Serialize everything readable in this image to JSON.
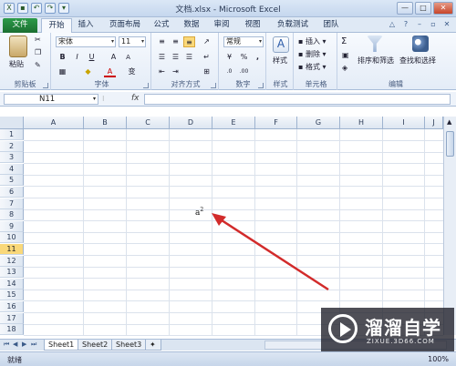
{
  "window": {
    "title": "文档.xlsx - Microsoft Excel",
    "minimize": "—",
    "maximize": "□",
    "close": "✕"
  },
  "tabs": [
    "文件",
    "开始",
    "插入",
    "页面布局",
    "公式",
    "数据",
    "审阅",
    "视图",
    "负载测试",
    "团队"
  ],
  "ribbon": {
    "clipboard": {
      "label": "剪贴板",
      "paste": "粘贴"
    },
    "font": {
      "label": "字体",
      "name": "宋体",
      "size": "11",
      "bold": "B",
      "italic": "I",
      "underline": "U",
      "grow": "A",
      "shrink": "A",
      "color": "A",
      "wen": "变"
    },
    "alignment": {
      "label": "对齐方式"
    },
    "number": {
      "label": "数字",
      "format": "常规",
      "percent": "%",
      "comma": ","
    },
    "styles": {
      "label": "样式",
      "button": "样式"
    },
    "cells": {
      "label": "单元格",
      "insert": "插入",
      "delete": "删除",
      "format": "格式"
    },
    "editing": {
      "label": "编辑",
      "sigma": "Σ",
      "sort": "排序和筛选",
      "find": "查找和选择"
    }
  },
  "formula_bar": {
    "name_box": "N11",
    "fx": "fx",
    "content": ""
  },
  "grid": {
    "columns": [
      "A",
      "B",
      "C",
      "D",
      "E",
      "F",
      "G",
      "H",
      "I",
      "J"
    ],
    "rows": [
      "1",
      "2",
      "3",
      "4",
      "5",
      "6",
      "7",
      "8",
      "9",
      "10",
      "11",
      "12",
      "13",
      "14",
      "15",
      "16",
      "17",
      "18"
    ],
    "active_row": "11",
    "cell_e8": {
      "base": "a",
      "sup": "2"
    }
  },
  "sheets": [
    "Sheet1",
    "Sheet2",
    "Sheet3"
  ],
  "status": {
    "ready": "就绪",
    "zoom": "100%"
  },
  "watermark": {
    "name": "溜溜自学",
    "url": "ZIXUE.3D66.COM"
  },
  "colors": {
    "file_tab": "#1b6f31",
    "arrow": "#d22b2b",
    "active_row": "#f9d87a"
  }
}
